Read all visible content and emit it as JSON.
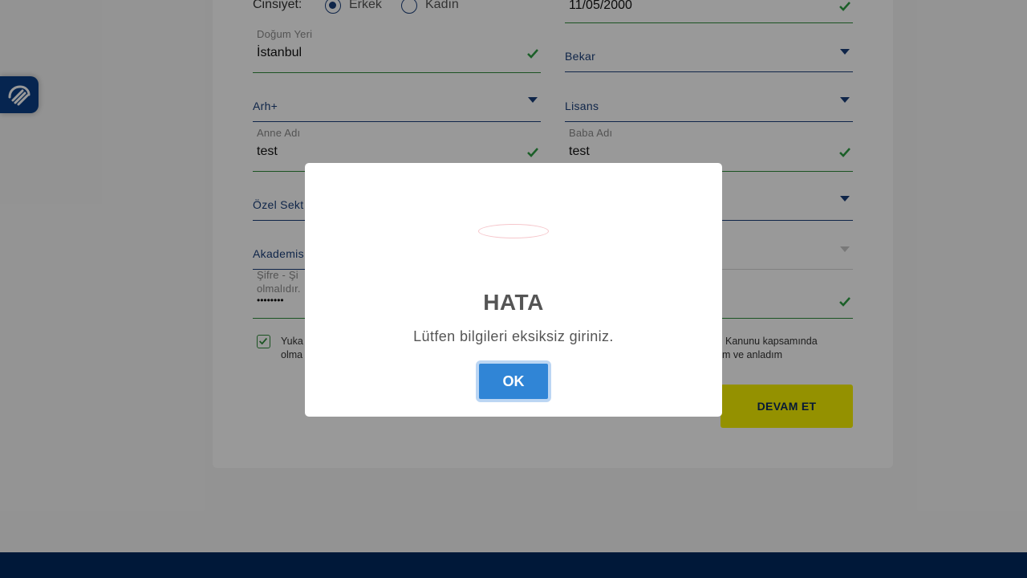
{
  "form": {
    "gender": {
      "label": "Cinsiyet:",
      "options": [
        "Erkek",
        "Kadın"
      ],
      "selected": "Erkek"
    },
    "birth_date": {
      "value": "11/05/2000"
    },
    "birth_place": {
      "label": "Doğum Yeri",
      "value": "İstanbul"
    },
    "marital_status": {
      "value": "Bekar"
    },
    "blood_type": {
      "value": "Arh+"
    },
    "education": {
      "value": "Lisans"
    },
    "mother_name": {
      "label": "Anne Adı",
      "value": "test"
    },
    "father_name": {
      "label": "Baba Adı",
      "value": "test"
    },
    "sector": {
      "value": "Özel Sekt"
    },
    "occupation": {
      "value": "Akademis"
    },
    "password": {
      "label_line1": "Şifre - Şi",
      "label_line2": "olmalıdır.",
      "value": "••••••••"
    },
    "consent": {
      "left_line1": "Yuka",
      "left_line2": "olma",
      "right_line1": "Kanunu kapsamında",
      "right_line2": "m ve anladım"
    },
    "continue_button": "DEVAM ET"
  },
  "modal": {
    "title": "HATA",
    "message": "Lütfen bilgileri eksiksiz giriniz.",
    "ok_label": "OK"
  },
  "icons": {
    "accessibility": "accessibility-hand-icon",
    "check": "check-icon",
    "caret": "caret-down-icon"
  },
  "colors": {
    "primary": "#00285f",
    "valid": "#2e8b3a",
    "cta": "#f7f200",
    "modal_button": "#3085d6"
  }
}
